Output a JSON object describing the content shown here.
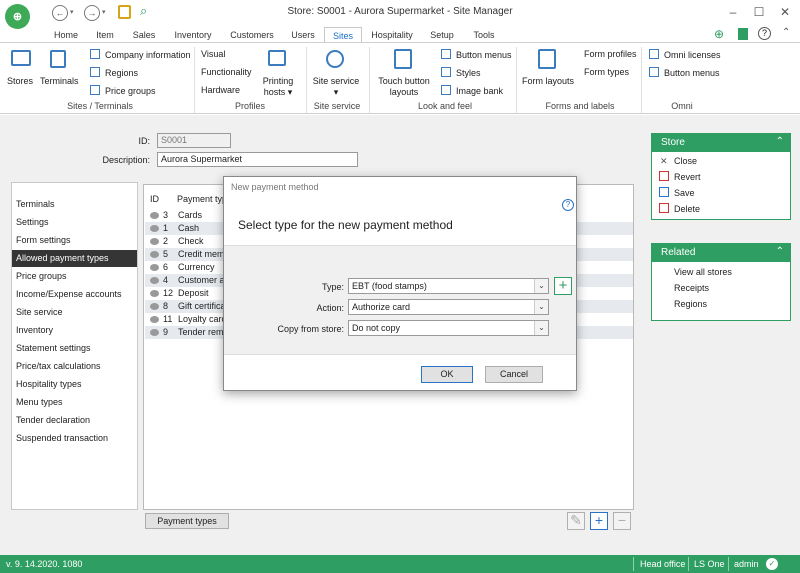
{
  "window": {
    "title": "Store: S0001 - Aurora Supermarket - Site Manager"
  },
  "logo": {
    "icon": "app-logo"
  },
  "quick": {
    "back": "←",
    "forward": "→"
  },
  "menu_tabs": [
    "Home",
    "Item",
    "Sales",
    "Inventory",
    "Customers",
    "Users",
    "Sites",
    "Hospitality",
    "Setup",
    "Tools"
  ],
  "active_tab": "Sites",
  "ribbon": {
    "stores": "Stores",
    "terminals": "Terminals",
    "company_info": "Company information",
    "regions": "Regions",
    "price_groups": "Price groups",
    "g1": "Sites / Terminals",
    "visual": "Visual",
    "functionality": "Functionality",
    "hardware": "Hardware",
    "printing1": "Printing",
    "printing2": "hosts",
    "g2": "Profiles",
    "site_service": "Site service",
    "g3": "Site service",
    "touch1": "Touch button",
    "touch2": "layouts",
    "button_menus": "Button menus",
    "styles": "Styles",
    "image_bank": "Image bank",
    "g4": "Look and feel",
    "form_layouts": "Form layouts",
    "form_profiles": "Form profiles",
    "form_types": "Form types",
    "g5": "Forms and labels",
    "omni_licenses": "Omni licenses",
    "omni_button_menus": "Button menus",
    "g6": "Omni"
  },
  "form": {
    "id_label": "ID:",
    "id_value": "S0001",
    "desc_label": "Description:",
    "desc_value": "Aurora Supermarket"
  },
  "nav": [
    "Terminals",
    "Settings",
    "Form settings",
    "Allowed payment types",
    "Price groups",
    "Income/Expense accounts",
    "Site service",
    "Inventory",
    "Statement settings",
    "Price/tax calculations",
    "Hospitality types",
    "Menu types",
    "Tender declaration",
    "Suspended transaction"
  ],
  "nav_selected": 3,
  "table": {
    "col_id": "ID",
    "col_name": "Payment typ",
    "rows": [
      [
        "3",
        "Cards"
      ],
      [
        "1",
        "Cash"
      ],
      [
        "2",
        "Check"
      ],
      [
        "5",
        "Credit memo"
      ],
      [
        "6",
        "Currency"
      ],
      [
        "4",
        "Customer ac"
      ],
      [
        "12",
        "Deposit"
      ],
      [
        "8",
        "Gift certifica"
      ],
      [
        "11",
        "Loyalty card"
      ],
      [
        "9",
        "Tender remo"
      ]
    ]
  },
  "payment_types_btn": "Payment types",
  "store_panel": {
    "title": "Store",
    "items": [
      "Close",
      "Revert",
      "Save",
      "Delete"
    ]
  },
  "related_panel": {
    "title": "Related",
    "items": [
      "View all stores",
      "Receipts",
      "Regions"
    ]
  },
  "status": {
    "version": "v. 9. 14.2020. 1080",
    "office": "Head office",
    "product": "LS One",
    "user": "admin"
  },
  "dialog": {
    "title": "New payment method",
    "heading": "Select type for the new payment method",
    "type_label": "Type:",
    "type_value": "EBT (food stamps)",
    "action_label": "Action:",
    "action_value": "Authorize card",
    "copy_label": "Copy from store:",
    "copy_value": "Do not copy",
    "ok": "OK",
    "cancel": "Cancel"
  }
}
